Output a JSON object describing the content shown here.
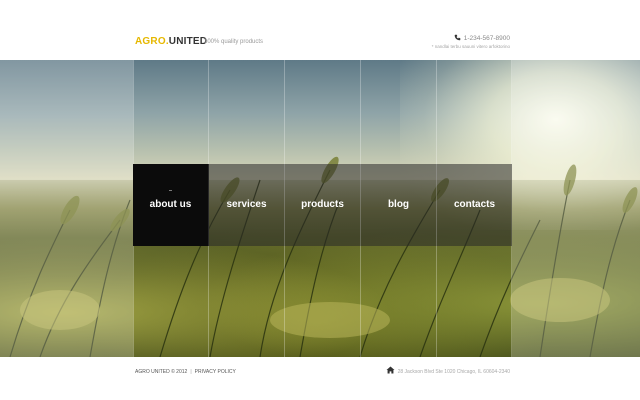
{
  "header": {
    "logo_part1": "AGRO",
    "logo_part2": "UNITED",
    "slogan": "100% quality products",
    "phone": "1-234-567-8900",
    "phone_note": "* nandlai terbu sauuni vitero arfoktorino",
    "phone_icon": "phone-icon"
  },
  "nav": {
    "items": [
      {
        "label": "about us",
        "active": true
      },
      {
        "label": "services",
        "active": false
      },
      {
        "label": "products",
        "active": false
      },
      {
        "label": "blog",
        "active": false
      },
      {
        "label": "contacts",
        "active": false
      }
    ]
  },
  "footer": {
    "copyright": "AGRO UNITED © 2012",
    "separator": "|",
    "privacy": "PRIVACY POLICY",
    "address": "28 Jackson Blvd Ste 1020 Chicago, IL 60604-2340",
    "address_icon": "home-icon"
  },
  "colors": {
    "accent": "#e6b800",
    "nav_active": "#0b0b0b",
    "nav_inactive": "rgba(40,40,40,0.55)",
    "text_dark": "#333333"
  }
}
